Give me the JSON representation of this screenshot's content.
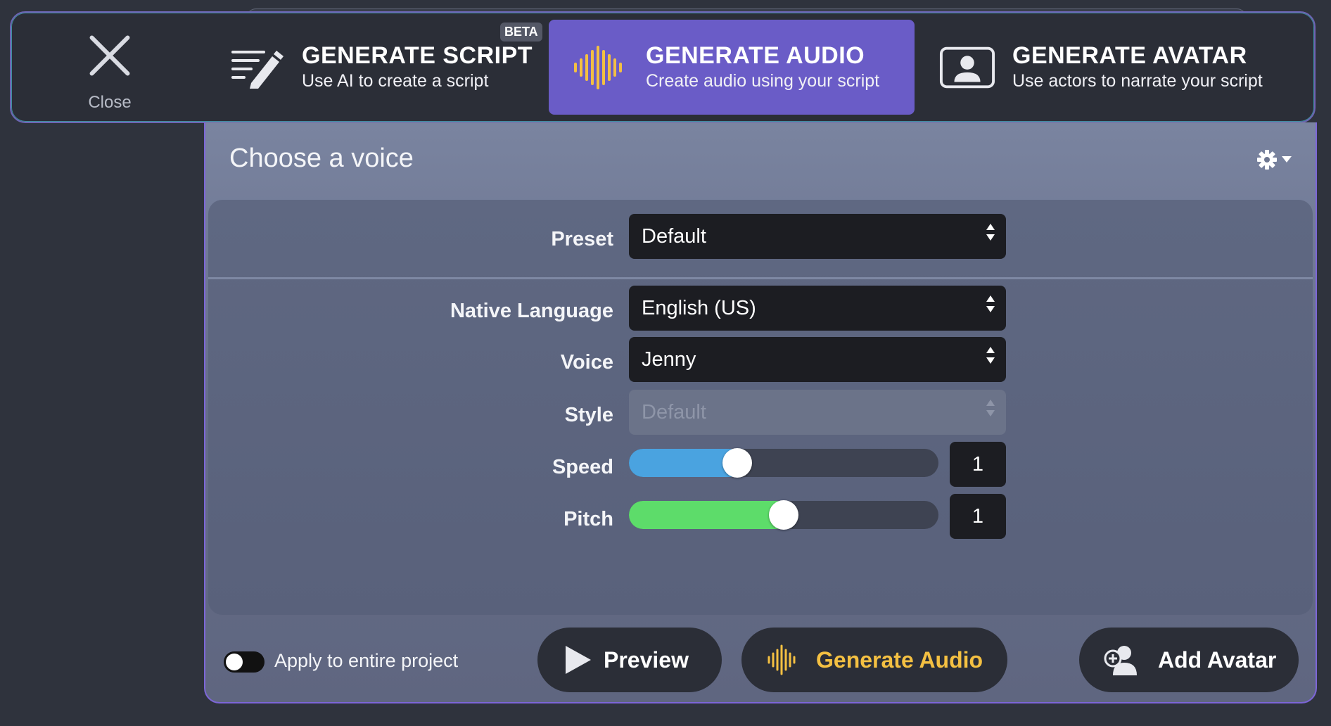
{
  "top_bar": {
    "close_label": "Close",
    "tabs": [
      {
        "title": "GENERATE SCRIPT",
        "subtitle": "Use AI to create a script",
        "badge": "BETA",
        "icon": "pencil-lines-icon"
      },
      {
        "title": "GENERATE AUDIO",
        "subtitle": "Create audio using your script",
        "icon": "waveform-icon",
        "active": true
      },
      {
        "title": "GENERATE AVATAR",
        "subtitle": "Use actors to narrate your script",
        "icon": "avatar-frame-icon"
      }
    ]
  },
  "panel": {
    "title": "Choose a voice",
    "preset": {
      "label": "Preset",
      "value": "Default"
    },
    "native_language": {
      "label": "Native Language",
      "value": "English (US)"
    },
    "voice": {
      "label": "Voice",
      "value": "Jenny"
    },
    "style": {
      "label": "Style",
      "value": "Default",
      "disabled": true
    },
    "speed": {
      "label": "Speed",
      "value": "1",
      "level": 0.35
    },
    "pitch": {
      "label": "Pitch",
      "value": "1",
      "level": 0.5
    }
  },
  "footer": {
    "apply_label": "Apply to entire project",
    "apply_on": false,
    "preview_label": "Preview",
    "generate_label": "Generate Audio",
    "add_avatar_label": "Add Avatar"
  },
  "colors": {
    "accent": "#6a5cc7",
    "speed_fill": "#4aa3e0",
    "pitch_fill": "#5ddc6a",
    "generate_text": "#f4c042"
  }
}
